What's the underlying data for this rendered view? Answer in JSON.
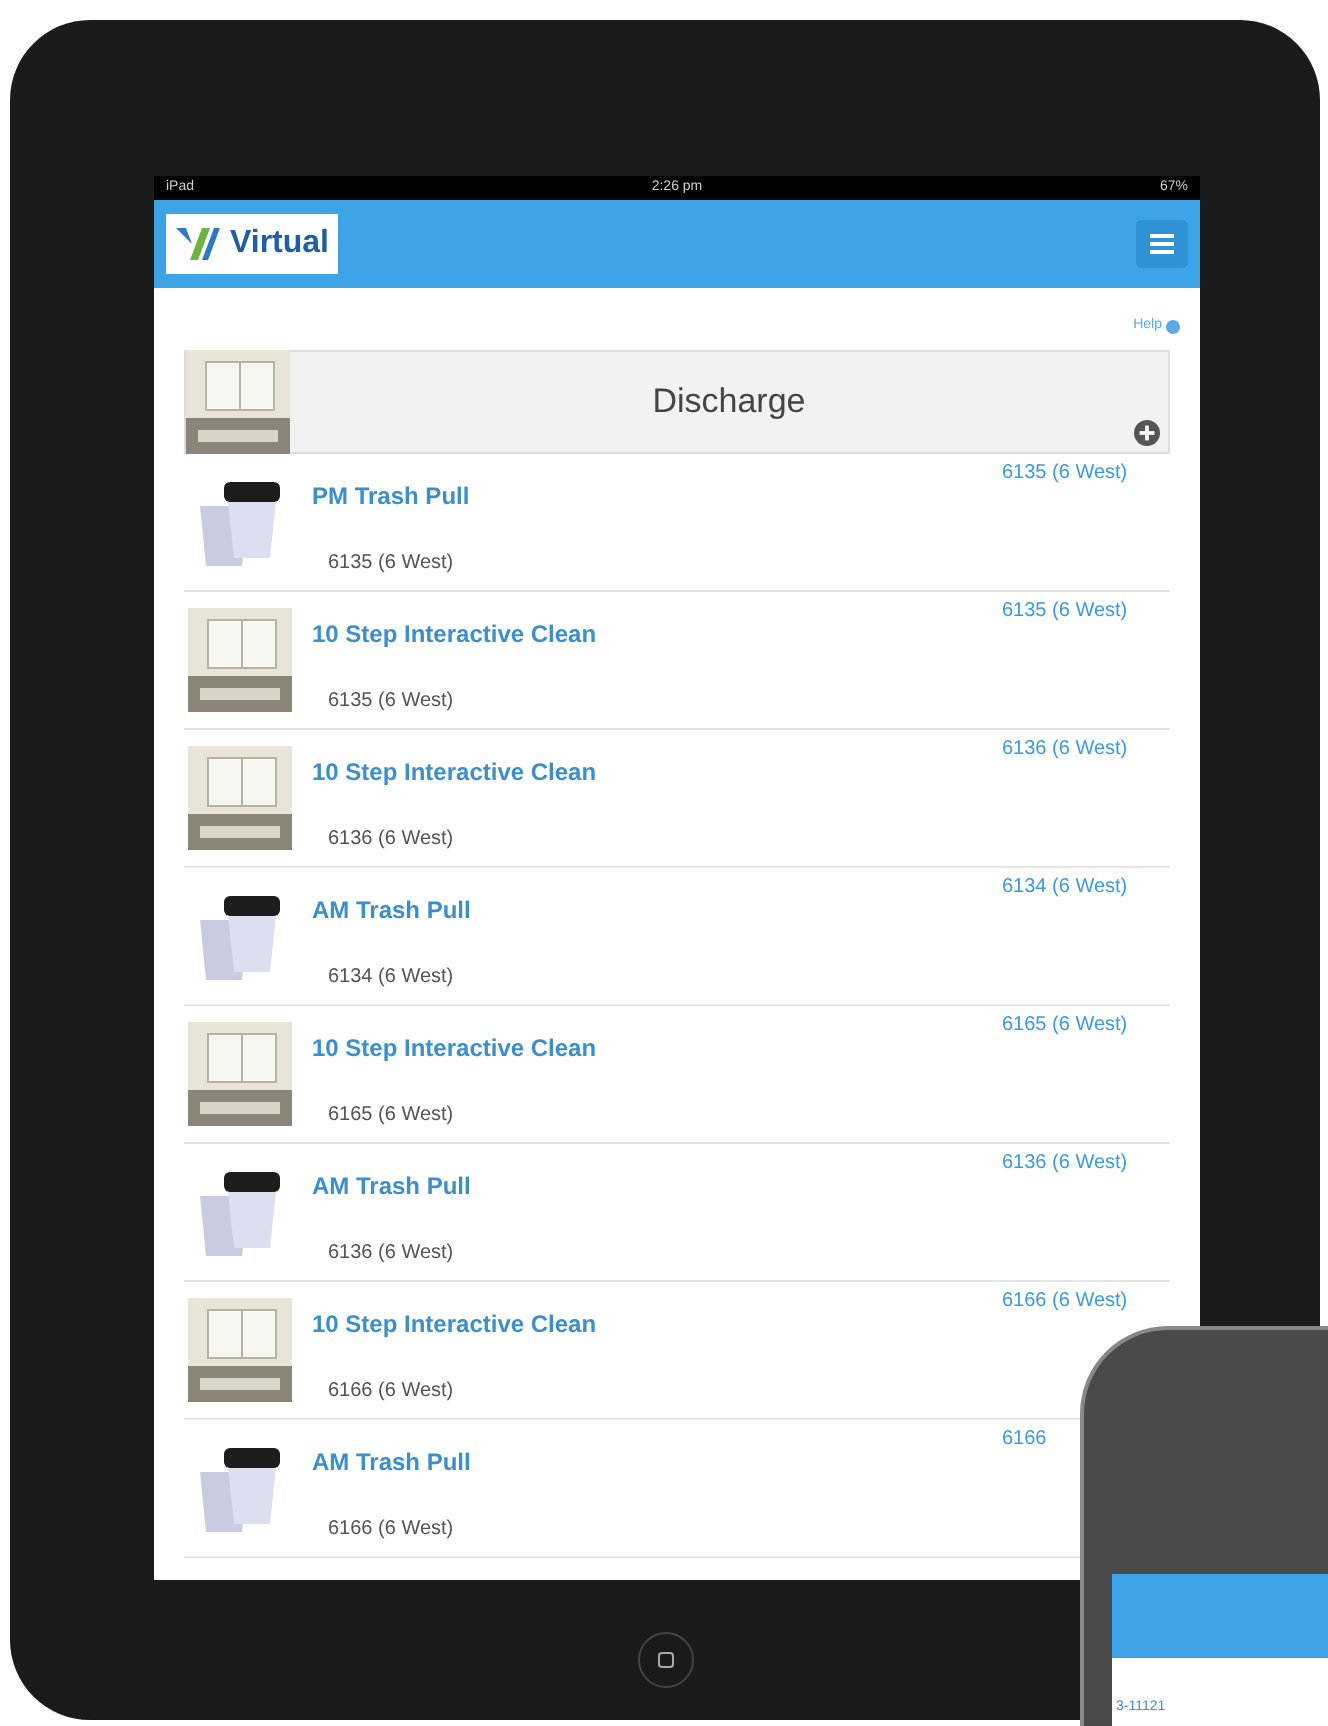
{
  "status_bar": {
    "device": "iPad",
    "time": "2:26 pm",
    "battery": "67%"
  },
  "header": {
    "logo_text": "Virtual"
  },
  "help_link": "Help",
  "category": {
    "title": "Discharge",
    "kind": "room"
  },
  "tasks": [
    {
      "kind": "trash",
      "title": "PM Trash Pull",
      "location": "6135 (6 West)",
      "room": "6135 (6 West)"
    },
    {
      "kind": "room",
      "title": "10 Step Interactive Clean",
      "location": "6135 (6 West)",
      "room": "6135 (6 West)"
    },
    {
      "kind": "room",
      "title": "10 Step Interactive Clean",
      "location": "6136 (6 West)",
      "room": "6136 (6 West)"
    },
    {
      "kind": "trash",
      "title": "AM Trash Pull",
      "location": "6134 (6 West)",
      "room": "6134 (6 West)"
    },
    {
      "kind": "room",
      "title": "10 Step Interactive Clean",
      "location": "6165 (6 West)",
      "room": "6165 (6 West)"
    },
    {
      "kind": "trash",
      "title": "AM Trash Pull",
      "location": "6136 (6 West)",
      "room": "6136 (6 West)"
    },
    {
      "kind": "room",
      "title": "10 Step Interactive Clean",
      "location": "6166 (6 West)",
      "room": "6166 (6 West)"
    },
    {
      "kind": "trash",
      "title": "AM Trash Pull",
      "location": "6166 (6 West)",
      "room": "6166"
    }
  ],
  "phone": {
    "item": "3-11121"
  }
}
